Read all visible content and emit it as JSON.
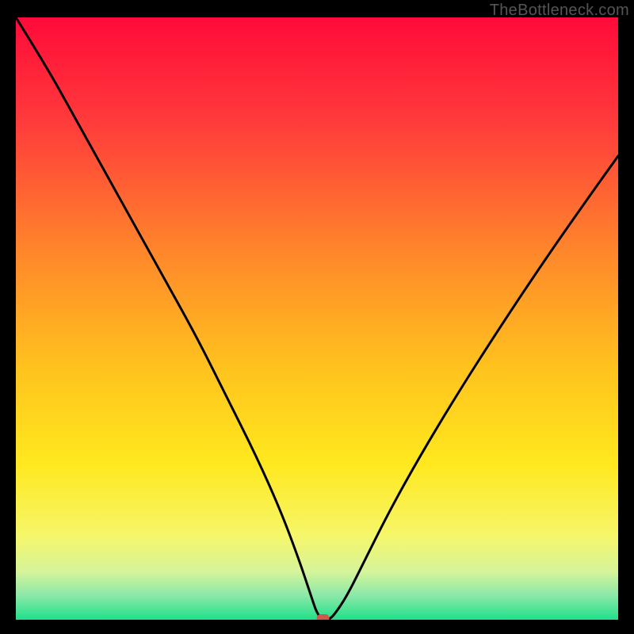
{
  "watermark": {
    "text": "TheBottleneck.com"
  },
  "chart_data": {
    "type": "line",
    "title": "",
    "xlabel": "",
    "ylabel": "",
    "xlim": [
      0,
      100
    ],
    "ylim": [
      0,
      100
    ],
    "grid": false,
    "legend": false,
    "series": [
      {
        "name": "bottleneck-curve",
        "x": [
          0,
          5,
          10,
          15,
          20,
          25,
          30,
          35,
          40,
          44,
          47,
          49,
          50,
          51,
          52,
          53,
          55,
          58,
          62,
          67,
          73,
          80,
          88,
          95,
          100
        ],
        "y": [
          100,
          92,
          83,
          74,
          65,
          56,
          47,
          37,
          27,
          18,
          10,
          4,
          1,
          0,
          0,
          1,
          4,
          10,
          18,
          27,
          37,
          48,
          60,
          70,
          77
        ]
      }
    ],
    "marker": {
      "x": 51,
      "y": 0,
      "shape": "rounded-rect",
      "color": "#d3564a"
    },
    "background_gradient": {
      "stops": [
        {
          "offset": 0.0,
          "color": "#ff0a3a"
        },
        {
          "offset": 0.18,
          "color": "#ff3d3b"
        },
        {
          "offset": 0.4,
          "color": "#ff8a2a"
        },
        {
          "offset": 0.58,
          "color": "#ffc21e"
        },
        {
          "offset": 0.74,
          "color": "#ffe81e"
        },
        {
          "offset": 0.86,
          "color": "#f6f66a"
        },
        {
          "offset": 0.92,
          "color": "#d6f49a"
        },
        {
          "offset": 0.96,
          "color": "#8ae8a8"
        },
        {
          "offset": 1.0,
          "color": "#1fe08a"
        }
      ]
    }
  }
}
